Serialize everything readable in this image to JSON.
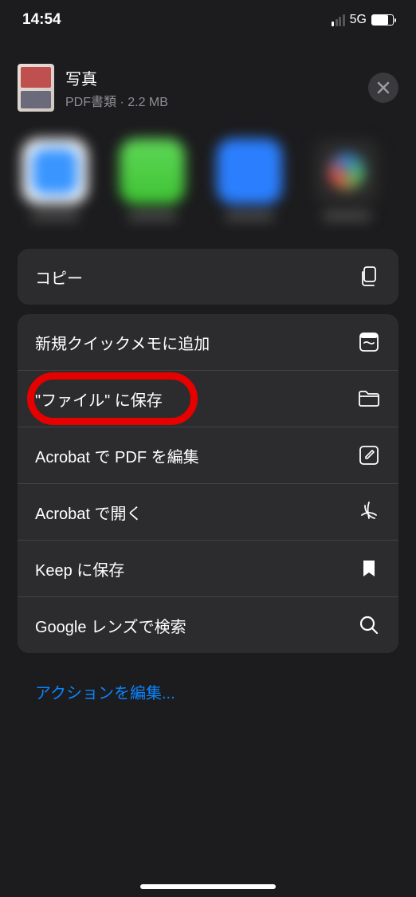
{
  "status": {
    "time": "14:54",
    "network": "5G"
  },
  "header": {
    "title": "写真",
    "subtitle": "PDF書類 · 2.2 MB"
  },
  "actions": {
    "copy": "コピー",
    "quicknote": "新規クイックメモに追加",
    "save_files": "\"ファイル\" に保存",
    "acrobat_edit": "Acrobat で PDF を編集",
    "acrobat_open": "Acrobat で開く",
    "keep": "Keep に保存",
    "lens": "Google レンズで検索"
  },
  "edit_actions": "アクションを編集..."
}
